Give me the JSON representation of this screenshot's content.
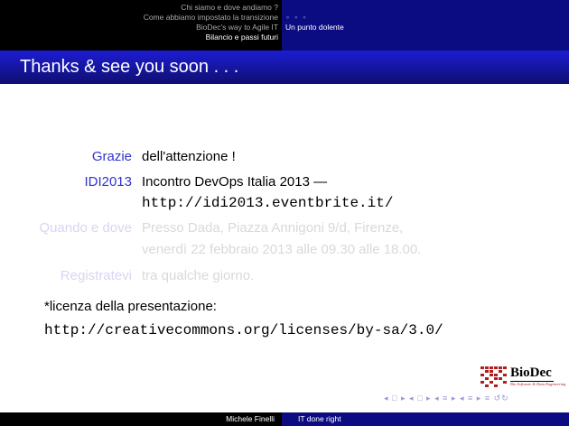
{
  "headline": {
    "sections": [
      "Chi siamo e dove andiamo ?",
      "Come abbiamo impostato la transizione",
      "BioDec's way to Agile IT",
      "Bilancio e passi futuri"
    ],
    "active_section_index": 3,
    "subsection_dots": "∘ ∘ ∘",
    "subsection_label": "Un punto dolente"
  },
  "frame": {
    "title": "Thanks & see you soon . . ."
  },
  "description": [
    {
      "term": "Grazie",
      "lines": [
        "dell'attenzione !"
      ],
      "faded": false
    },
    {
      "term": "IDI2013",
      "lines": [
        "Incontro DevOps Italia 2013 —"
      ],
      "mono_line": "http://idi2013.eventbrite.it/",
      "faded": false
    },
    {
      "term": "Quando e dove",
      "lines": [
        "Presso Dada, Piazza Annigoni 9/d, Firenze,",
        "venerdì 22 febbraio 2013 alle 09.30 alle 18.00."
      ],
      "faded": true
    },
    {
      "term": "Registratevi",
      "lines": [
        "tra qualche giorno."
      ],
      "faded": true
    }
  ],
  "license": {
    "label": "*licenza della presentazione:",
    "url": "http://creativecommons.org/licenses/by-sa/3.0/"
  },
  "logo": {
    "text": "BioDec",
    "tagline": "Bio Software & Data Engineering"
  },
  "navigation": {
    "symbols": [
      "◂",
      "□",
      "▸",
      "◂",
      "□",
      "▸",
      "◂",
      "≡",
      "▸",
      "◂",
      "≡",
      "▸",
      "≡",
      "↺↻"
    ]
  },
  "footline": {
    "author": "Michele Finelli",
    "title": "IT done right"
  },
  "colors": {
    "accent": "#3333cc",
    "dark_blue": "#0c0c82",
    "black": "#000000"
  }
}
